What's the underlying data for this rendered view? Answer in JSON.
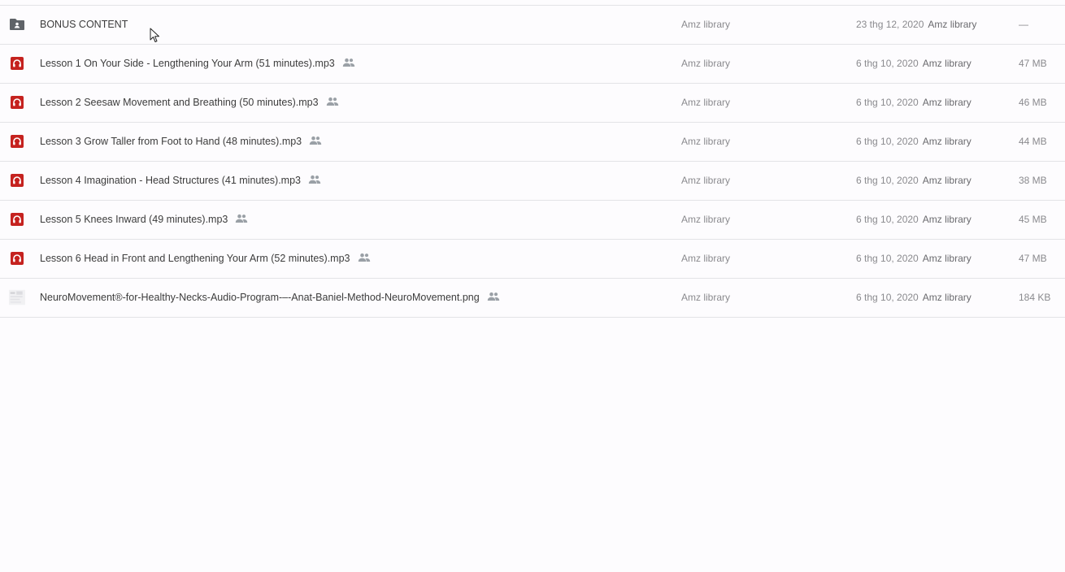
{
  "files": [
    {
      "type": "folder",
      "icon": "shared-folder-icon",
      "name": "BONUS CONTENT",
      "shared": false,
      "owner": "Amz library",
      "modified_date": "23 thg 12, 2020",
      "modified_by": "Amz library",
      "size": "—"
    },
    {
      "type": "audio",
      "icon": "headphones-icon",
      "name": "Lesson 1 On Your Side - Lengthening Your Arm (51 minutes).mp3",
      "shared": true,
      "owner": "Amz library",
      "modified_date": "6 thg 10, 2020",
      "modified_by": "Amz library",
      "size": "47 MB"
    },
    {
      "type": "audio",
      "icon": "headphones-icon",
      "name": "Lesson 2 Seesaw Movement and Breathing (50 minutes).mp3",
      "shared": true,
      "owner": "Amz library",
      "modified_date": "6 thg 10, 2020",
      "modified_by": "Amz library",
      "size": "46 MB"
    },
    {
      "type": "audio",
      "icon": "headphones-icon",
      "name": "Lesson 3 Grow Taller from Foot to Hand (48 minutes).mp3",
      "shared": true,
      "owner": "Amz library",
      "modified_date": "6 thg 10, 2020",
      "modified_by": "Amz library",
      "size": "44 MB"
    },
    {
      "type": "audio",
      "icon": "headphones-icon",
      "name": "Lesson 4 Imagination - Head Structures (41 minutes).mp3",
      "shared": true,
      "owner": "Amz library",
      "modified_date": "6 thg 10, 2020",
      "modified_by": "Amz library",
      "size": "38 MB"
    },
    {
      "type": "audio",
      "icon": "headphones-icon",
      "name": "Lesson 5 Knees Inward (49 minutes).mp3",
      "shared": true,
      "owner": "Amz library",
      "modified_date": "6 thg 10, 2020",
      "modified_by": "Amz library",
      "size": "45 MB"
    },
    {
      "type": "audio",
      "icon": "headphones-icon",
      "name": "Lesson 6 Head in Front and Lengthening Your Arm (52 minutes).mp3",
      "shared": true,
      "owner": "Amz library",
      "modified_date": "6 thg 10, 2020",
      "modified_by": "Amz library",
      "size": "47 MB"
    },
    {
      "type": "image",
      "icon": "image-thumbnail-icon",
      "name": "NeuroMovement®-for-Healthy-Necks-Audio-Program-–-Anat-Baniel-Method-NeuroMovement.png",
      "shared": true,
      "owner": "Amz library",
      "modified_date": "6 thg 10, 2020",
      "modified_by": "Amz library",
      "size": "184 KB"
    }
  ],
  "colors": {
    "audio_icon": "#c5221f",
    "folder_icon": "#5f6368",
    "shared_icon": "#9aa0a6",
    "divider": "#e3e3e6"
  },
  "shared_icon": "people-icon",
  "pointer": "mouse-cursor-icon"
}
